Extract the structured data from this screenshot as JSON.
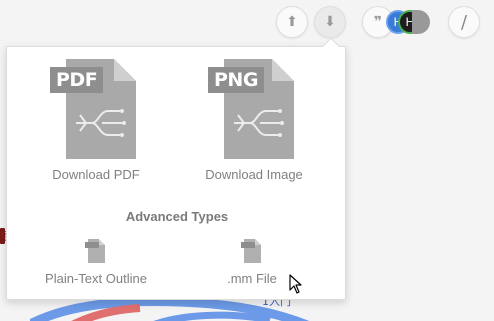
{
  "toolbar": {
    "upload_icon": "upload-icon",
    "download_icon": "download-icon",
    "comment_glyph": "❞",
    "comment_icon": "comment-icon",
    "avatar_initials": [
      "H",
      "H"
    ],
    "slash_glyph": "/",
    "upload_glyph": "⬆",
    "download_glyph": "⬇"
  },
  "export_menu": {
    "primary": [
      {
        "tag": "PDF",
        "label": "Download PDF"
      },
      {
        "tag": "PNG",
        "label": "Download Image"
      }
    ],
    "section_title": "Advanced Types",
    "advanced": [
      {
        "label": "Plain-Text Outline"
      },
      {
        "label": ".mm File"
      }
    ]
  },
  "canvas": {
    "left_edge_text": "项",
    "bottom_text": "1入门"
  },
  "colors": {
    "panel_bg": "#ffffff",
    "doc_gray": "#a9a9a9",
    "tag_gray": "#8e8e8e",
    "caption_gray": "#808080",
    "avatar_blue": "#3a7bd5",
    "avatar_green_ring": "#4caf50",
    "canvas_blue": "#5b8ee6",
    "canvas_red": "#e06060"
  }
}
